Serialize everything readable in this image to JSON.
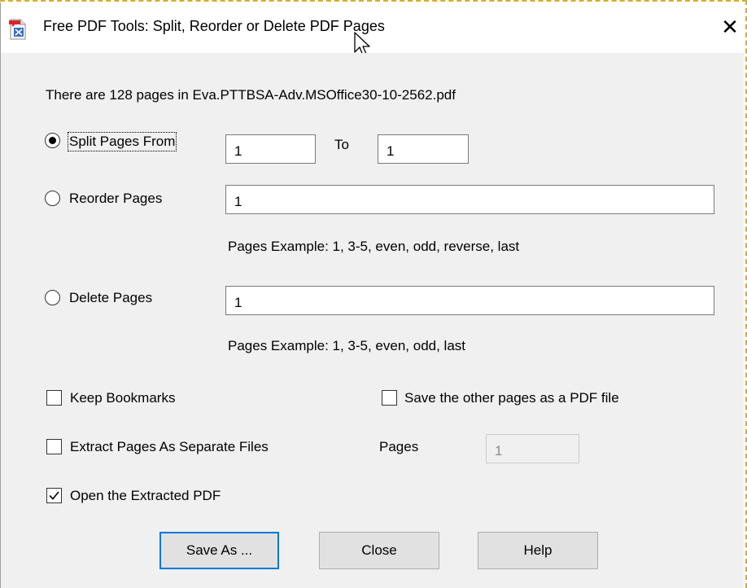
{
  "window": {
    "title": "Free PDF Tools: Split, Reorder or Delete PDF Pages",
    "close_glyph": "✕",
    "app_icon": "pdf-tools-icon"
  },
  "info": {
    "page_count_text": "There are 128 pages in Eva.PTTBSA-Adv.MSOffice30-10-2562.pdf"
  },
  "split": {
    "label": "Split Pages From",
    "selected": true,
    "from_value": "1",
    "to_label": "To",
    "to_value": "1"
  },
  "reorder": {
    "label": "Reorder Pages",
    "selected": false,
    "value": "1",
    "example": "Pages Example: 1, 3-5, even, odd, reverse, last"
  },
  "delete": {
    "label": "Delete Pages",
    "selected": false,
    "value": "1",
    "example": "Pages Example: 1, 3-5, even, odd, last"
  },
  "options": {
    "keep_bookmarks": {
      "label": "Keep Bookmarks",
      "checked": false
    },
    "save_other_pages": {
      "label": "Save the other pages as a PDF file",
      "checked": false
    },
    "extract_separate": {
      "label": "Extract Pages As Separate Files",
      "checked": false
    },
    "pages_label": "Pages",
    "pages_value": "1",
    "open_extracted": {
      "label": "Open the Extracted PDF",
      "checked": true
    }
  },
  "buttons": {
    "save_as": "Save As ...",
    "close": "Close",
    "help": "Help"
  },
  "colors": {
    "dialog_bg": "#f0f0f0",
    "default_button_border": "#0078d7",
    "pdf_icon_red": "#d8262f"
  }
}
